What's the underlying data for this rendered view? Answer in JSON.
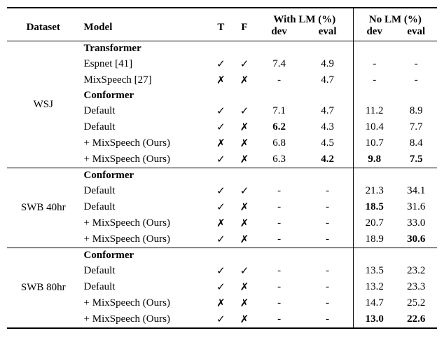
{
  "header": {
    "dataset": "Dataset",
    "model": "Model",
    "t": "T",
    "f": "F",
    "withlm": "With LM (%)",
    "nolm": "No LM (%)",
    "dev": "dev",
    "eval": "eval"
  },
  "groups": [
    {
      "dataset": "WSJ",
      "sections": [
        {
          "title": "Transformer",
          "rows": [
            {
              "model": "Espnet [41]",
              "t": "✓",
              "f": "✓",
              "wlm_dev": "7.4",
              "wlm_eval": "4.9",
              "nlm_dev": "-",
              "nlm_eval": "-"
            },
            {
              "model": "MixSpeech [27]",
              "t": "✗",
              "f": "✗",
              "wlm_dev": "-",
              "wlm_eval": "4.7",
              "nlm_dev": "-",
              "nlm_eval": "-"
            }
          ]
        },
        {
          "title": "Conformer",
          "rows": [
            {
              "model": "Default",
              "t": "✓",
              "f": "✓",
              "wlm_dev": "7.1",
              "wlm_eval": "4.7",
              "nlm_dev": "11.2",
              "nlm_eval": "8.9"
            },
            {
              "model": "Default",
              "t": "✓",
              "f": "✗",
              "wlm_dev": "6.2",
              "wlm_dev_bold": true,
              "wlm_eval": "4.3",
              "nlm_dev": "10.4",
              "nlm_eval": "7.7"
            },
            {
              "model": "+ MixSpeech (Ours)",
              "t": "✗",
              "f": "✗",
              "wlm_dev": "6.8",
              "wlm_eval": "4.5",
              "nlm_dev": "10.7",
              "nlm_eval": "8.4"
            },
            {
              "model": "+ MixSpeech (Ours)",
              "t": "✓",
              "f": "✗",
              "wlm_dev": "6.3",
              "wlm_eval": "4.2",
              "wlm_eval_bold": true,
              "nlm_dev": "9.8",
              "nlm_dev_bold": true,
              "nlm_eval": "7.5",
              "nlm_eval_bold": true
            }
          ]
        }
      ]
    },
    {
      "dataset": "SWB 40hr",
      "sections": [
        {
          "title": "Conformer",
          "rows": [
            {
              "model": "Default",
              "t": "✓",
              "f": "✓",
              "wlm_dev": "-",
              "wlm_eval": "-",
              "nlm_dev": "21.3",
              "nlm_eval": "34.1"
            },
            {
              "model": "Default",
              "t": "✓",
              "f": "✗",
              "wlm_dev": "-",
              "wlm_eval": "-",
              "nlm_dev": "18.5",
              "nlm_dev_bold": true,
              "nlm_eval": "31.6"
            },
            {
              "model": "+ MixSpeech (Ours)",
              "t": "✗",
              "f": "✗",
              "wlm_dev": "-",
              "wlm_eval": "-",
              "nlm_dev": "20.7",
              "nlm_eval": "33.0"
            },
            {
              "model": "+ MixSpeech (Ours)",
              "t": "✓",
              "f": "✗",
              "wlm_dev": "-",
              "wlm_eval": "-",
              "nlm_dev": "18.9",
              "nlm_eval": "30.6",
              "nlm_eval_bold": true
            }
          ]
        }
      ]
    },
    {
      "dataset": "SWB 80hr",
      "sections": [
        {
          "title": "Conformer",
          "rows": [
            {
              "model": "Default",
              "t": "✓",
              "f": "✓",
              "wlm_dev": "-",
              "wlm_eval": "-",
              "nlm_dev": "13.5",
              "nlm_eval": "23.2"
            },
            {
              "model": "Default",
              "t": "✓",
              "f": "✗",
              "wlm_dev": "-",
              "wlm_eval": "-",
              "nlm_dev": "13.2",
              "nlm_eval": "23.3"
            },
            {
              "model": "+ MixSpeech (Ours)",
              "t": "✗",
              "f": "✗",
              "wlm_dev": "-",
              "wlm_eval": "-",
              "nlm_dev": "14.7",
              "nlm_eval": "25.2"
            },
            {
              "model": "+ MixSpeech (Ours)",
              "t": "✓",
              "f": "✗",
              "wlm_dev": "-",
              "wlm_eval": "-",
              "nlm_dev": "13.0",
              "nlm_dev_bold": true,
              "nlm_eval": "22.6",
              "nlm_eval_bold": true
            }
          ]
        }
      ]
    }
  ]
}
